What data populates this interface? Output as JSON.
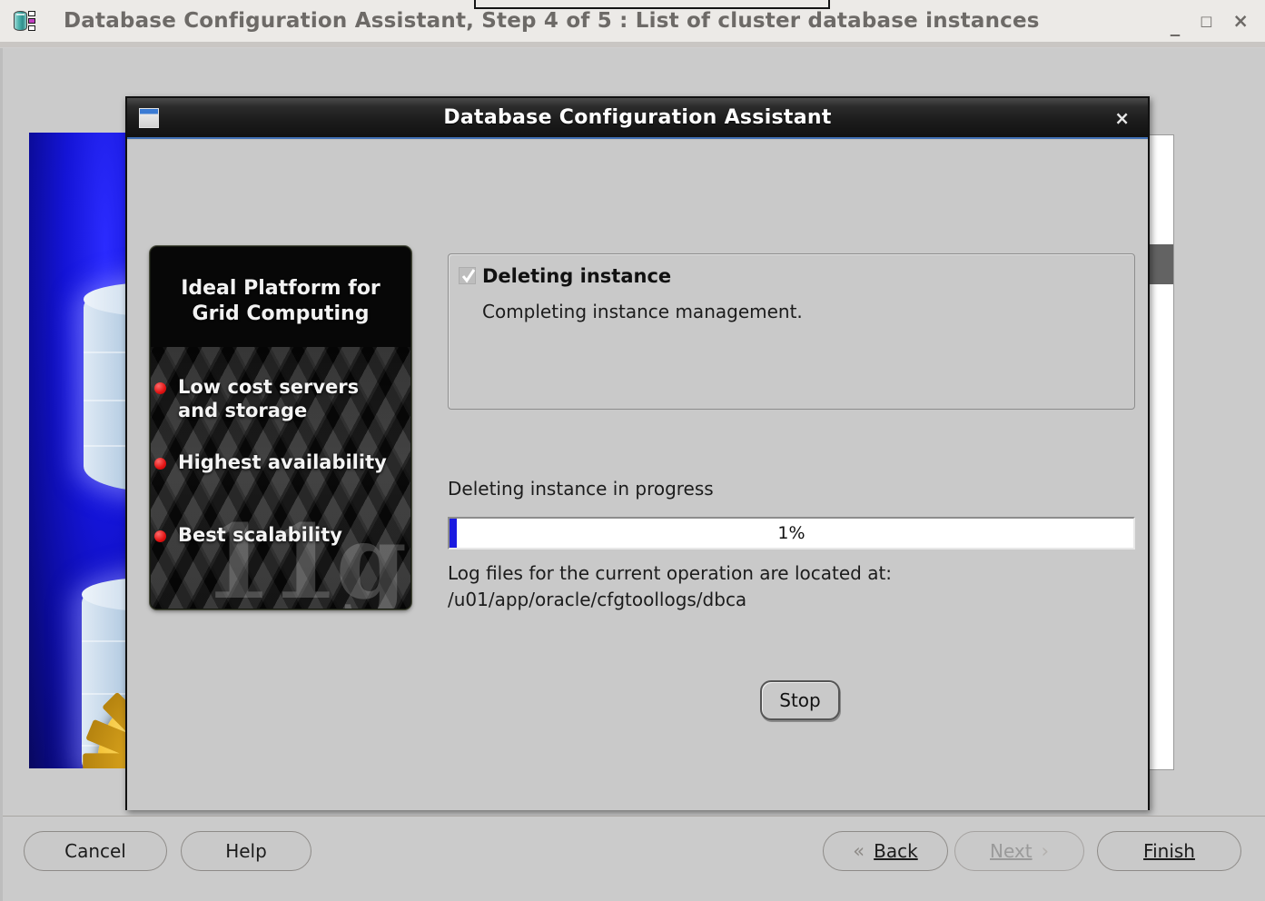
{
  "outer_window": {
    "title": "Database Configuration Assistant, Step 4 of 5 : List of cluster database instances",
    "icon": "database-app-icon",
    "controls": {
      "minimize": "_",
      "maximize": "□",
      "close": "×"
    }
  },
  "footer": {
    "cancel_label": "Cancel",
    "help_label": "Help",
    "back_label": "Back",
    "back_accel": "B",
    "next_label": "Next",
    "next_accel": "N",
    "next_enabled": false,
    "finish_label": "Finish",
    "finish_accel": "F",
    "back_chevron": "«",
    "next_chevron": "›"
  },
  "dialog": {
    "title": "Database Configuration Assistant",
    "close_label": "×",
    "branding": {
      "heading_line1": "Ideal Platform for",
      "heading_line2": "Grid Computing",
      "watermark": "11g",
      "bullets": [
        "Low cost servers and storage",
        "Highest availability",
        "Best scalability"
      ]
    },
    "status": {
      "title": "Deleting instance",
      "detail": "Completing instance management.",
      "check_icon": "checkmark-icon"
    },
    "progress": {
      "label": "Deleting instance in progress",
      "percent_text": "1%",
      "percent_value": 1,
      "fill_color": "#1b1be0"
    },
    "log": {
      "line1": "Log files for the current operation are located at:",
      "line2": "/u01/app/oracle/cfgtoollogs/dbca"
    },
    "stop_label": "Stop"
  },
  "colors": {
    "window_bg": "#cbcbcb",
    "titlebar_bg": "#eceae7",
    "dialog_title_bg": "#1b1b1b",
    "accent_blue": "#3f6fb5",
    "bullet_red": "#e01212",
    "splash_blue": "#0d0db4",
    "gear_gold": "#f5c63c"
  }
}
